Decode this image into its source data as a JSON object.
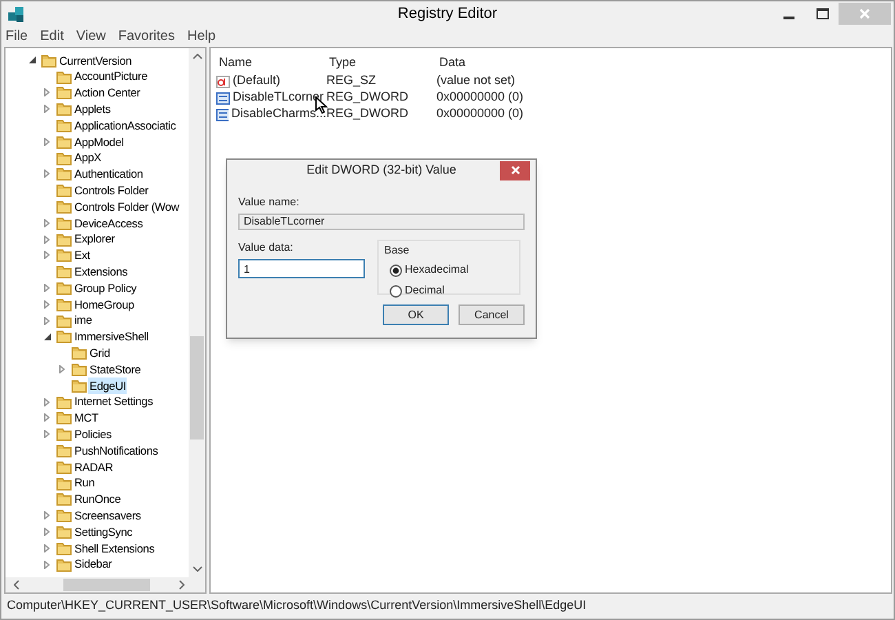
{
  "window": {
    "title": "Registry Editor"
  },
  "menu": [
    "File",
    "Edit",
    "View",
    "Favorites",
    "Help"
  ],
  "tree": [
    {
      "label": "CurrentVersion",
      "expanded": true,
      "selected": false,
      "children": [
        {
          "label": "AccountPicture",
          "selected": false
        },
        {
          "label": "Action Center",
          "expanded": false,
          "selected": false
        },
        {
          "label": "Applets",
          "expanded": false,
          "selected": false
        },
        {
          "label": "ApplicationAssociatic",
          "selected": false
        },
        {
          "label": "AppModel",
          "expanded": false,
          "selected": false
        },
        {
          "label": "AppX",
          "selected": false
        },
        {
          "label": "Authentication",
          "expanded": false,
          "selected": false
        },
        {
          "label": "Controls Folder",
          "selected": false
        },
        {
          "label": "Controls Folder (Wow",
          "selected": false
        },
        {
          "label": "DeviceAccess",
          "expanded": false,
          "selected": false
        },
        {
          "label": "Explorer",
          "expanded": false,
          "selected": false
        },
        {
          "label": "Ext",
          "expanded": false,
          "selected": false
        },
        {
          "label": "Extensions",
          "selected": false
        },
        {
          "label": "Group Policy",
          "expanded": false,
          "selected": false
        },
        {
          "label": "HomeGroup",
          "expanded": false,
          "selected": false
        },
        {
          "label": "ime",
          "expanded": false,
          "selected": false
        },
        {
          "label": "ImmersiveShell",
          "expanded": true,
          "selected": false,
          "children": [
            {
              "label": "Grid",
              "selected": false
            },
            {
              "label": "StateStore",
              "expanded": false,
              "selected": false
            },
            {
              "label": "EdgeUI",
              "selected": true
            }
          ]
        },
        {
          "label": "Internet Settings",
          "expanded": false,
          "selected": false
        },
        {
          "label": "MCT",
          "expanded": false,
          "selected": false
        },
        {
          "label": "Policies",
          "expanded": false,
          "selected": false
        },
        {
          "label": "PushNotifications",
          "selected": false
        },
        {
          "label": "RADAR",
          "selected": false
        },
        {
          "label": "Run",
          "selected": false
        },
        {
          "label": "RunOnce",
          "selected": false
        },
        {
          "label": "Screensavers",
          "expanded": false,
          "selected": false
        },
        {
          "label": "SettingSync",
          "expanded": false,
          "selected": false
        },
        {
          "label": "Shell Extensions",
          "expanded": false,
          "selected": false
        },
        {
          "label": "Sidebar",
          "expanded": false,
          "selected": false
        }
      ]
    }
  ],
  "values": {
    "columns": [
      "Name",
      "Type",
      "Data"
    ],
    "rows": [
      {
        "kind": "string",
        "name": "(Default)",
        "type": "REG_SZ",
        "data": "(value not set)"
      },
      {
        "kind": "binary",
        "name": "DisableTLcorner",
        "type": "REG_DWORD",
        "data": "0x00000000 (0)"
      },
      {
        "kind": "binary",
        "name": "DisableCharms...",
        "type": "REG_DWORD",
        "data": "0x00000000 (0)"
      }
    ]
  },
  "dialog": {
    "title": "Edit DWORD (32-bit) Value",
    "value_name_label": "Value name:",
    "value_name": "DisableTLcorner",
    "value_data_label": "Value data:",
    "value_data": "1",
    "base_label": "Base",
    "radios": [
      {
        "label": "Hexadecimal",
        "selected": true
      },
      {
        "label": "Decimal",
        "selected": false
      }
    ],
    "buttons": [
      "OK",
      "Cancel"
    ]
  },
  "status_bar": "Computer\\HKEY_CURRENT_USER\\Software\\Microsoft\\Windows\\CurrentVersion\\ImmersiveShell\\EdgeUI"
}
